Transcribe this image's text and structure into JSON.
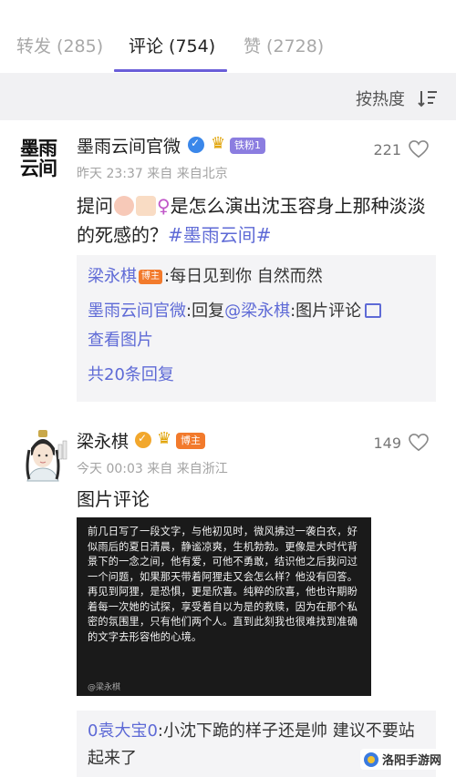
{
  "tabs": [
    {
      "label": "转发 (285)"
    },
    {
      "label": "评论 (754)",
      "active": true
    },
    {
      "label": "赞 (2728)"
    }
  ],
  "sort": {
    "label": "按热度",
    "icon": "sort-icon"
  },
  "comments": [
    {
      "avatar_text": "墨雨\n云间",
      "username": "墨雨云间官微",
      "verified_icon": "verified-blue-icon",
      "crown_icon": "crown-icon",
      "badge": "铁粉1",
      "meta": "昨天 23:37 来自 来自北京",
      "likes": "221",
      "text_before": "提问",
      "text_after": "是怎么演出沈玉容身上那种淡淡的死感的？",
      "female_symbol": "♀",
      "hashtag": "#墨雨云间#",
      "replies": [
        {
          "name": "梁永棋",
          "tag": "博主",
          "text": ":每日见到你 自然而然"
        },
        {
          "name": "墨雨云间官微",
          "text": ":回复",
          "mention": "@梁永棋",
          "text2": ":图片评论",
          "link": "查看图片"
        }
      ],
      "more_replies": "共20条回复"
    },
    {
      "username": "梁永棋",
      "verified_icon": "verified-gold-icon",
      "crown_icon": "crown-icon",
      "badge": "博主",
      "meta": "今天 00:03 来自 来自浙江",
      "likes": "149",
      "text": "图片评论",
      "image_text": "前几日写了一段文字，与他初见时，微风拂过一袭白衣，好似雨后的夏日清晨，静谧凉爽，生机勃勃。更像是大时代背景下的一念之间，他有爱，可他不勇敢，结识他之后我问过一个问题，如果那天带着阿狸走又会怎么样？他没有回答。再见到阿狸，是恐惧，更是欣喜。纯粹的欣喜，他也许期盼着每一次她的试探，享受着自以为是的救赎，因为在那个私密的氛围里，只有他们两个人。直到此刻我也很难找到准确的文字去形容他的心境。",
      "image_watermark": "@梁永棋",
      "sub_reply_name": "0袁大宝0",
      "sub_reply_text": ":小沈下跪的样子还是帅 建议不要站起来了"
    }
  ],
  "watermark": {
    "label": "洛阳手游网"
  },
  "colors": {
    "accent": "#6a5ed8",
    "link": "#5e6ad6",
    "verified_blue": "#3a87ea",
    "verified_gold": "#f2a72c",
    "bozhu": "#f27a2c",
    "fan_badge": "#8b7de0"
  }
}
